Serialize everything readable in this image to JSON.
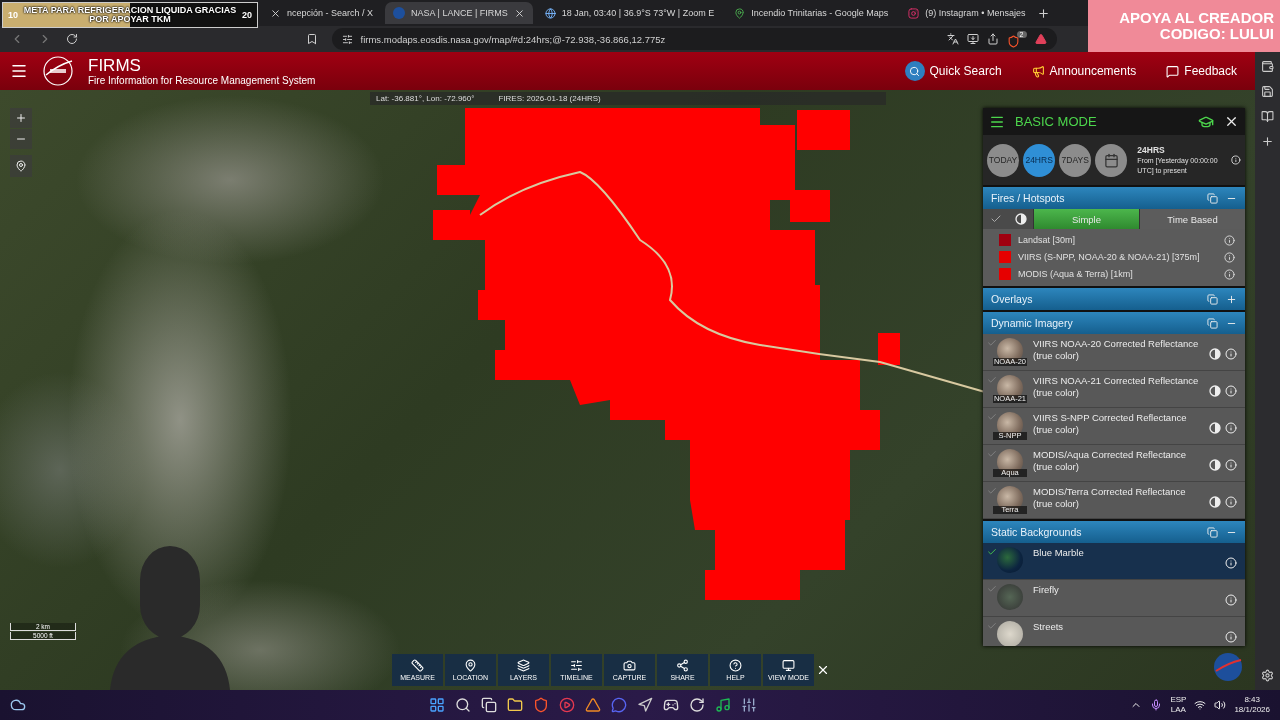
{
  "stream_overlays": {
    "goal": {
      "start": "10",
      "text": "META PARA REFRIGERACION LIQUIDA GRACIAS POR APOYAR TKM",
      "end": "20",
      "level": 0.5
    },
    "creator_banner": {
      "line1": "APOYA AL CREADOR",
      "line2": "CODIGO: LULUI"
    }
  },
  "browser": {
    "tabs": [
      {
        "title": "ncepción - Search / X",
        "kind": "x",
        "selected": false
      },
      {
        "title": "NASA | LANCE | FIRMS",
        "kind": "nasa",
        "selected": true
      },
      {
        "title": "18 Jan, 03:40 | 36.9°S 73°W | Zoom E",
        "kind": "globe",
        "selected": false
      },
      {
        "title": "Incendio Trinitarias - Google Maps",
        "kind": "maps",
        "selected": false
      },
      {
        "title": "(9) Instagram • Mensajes",
        "kind": "instagram",
        "selected": false
      }
    ],
    "url": "firms.modaps.eosdis.nasa.gov/map/#d:24hrs;@-72.938,-36.866,12.775z",
    "shield_badge": "2"
  },
  "header": {
    "title": "FIRMS",
    "subtitle": "Fire Information for Resource Management System",
    "actions": [
      {
        "label": "Quick Search",
        "kind": "search"
      },
      {
        "label": "Announcements",
        "kind": "announce"
      },
      {
        "label": "Feedback",
        "kind": "feedback"
      }
    ]
  },
  "map": {
    "coordinates": "Lat: -36.881°, Lon: -72.960°",
    "fires_date": "FIRES: 2026-01-18 (24HRS)",
    "scale": [
      "2 km",
      "5000 ft"
    ]
  },
  "panel": {
    "title": "BASIC MODE",
    "time_buttons": [
      {
        "label": "TODAY",
        "selected": false
      },
      {
        "label": "24HRS",
        "selected": true
      },
      {
        "label": "7DAYS",
        "selected": false
      }
    ],
    "range_title": "24HRS",
    "range_text": "From [Yesterday 00:00:00 UTC] to present",
    "sections": [
      {
        "title": "Fires / Hotspots",
        "kind": "hotspots",
        "expanded": true,
        "modes": [
          {
            "label": "Simple",
            "selected": true
          },
          {
            "label": "Time Based",
            "selected": false
          }
        ],
        "legend": [
          {
            "label": "Landsat [30m]",
            "color": "#a00010"
          },
          {
            "label": "VIIRS (S-NPP, NOAA-20 & NOAA-21) [375m]",
            "color": "#e60000"
          },
          {
            "label": "MODIS (Aqua & Terra) [1km]",
            "color": "#e60000"
          }
        ]
      },
      {
        "title": "Overlays",
        "kind": "layers",
        "expanded": false
      },
      {
        "title": "Dynamic Imagery",
        "kind": "layers",
        "expanded": true,
        "layers": [
          {
            "name": "VIIRS NOAA-20 Corrected Reflectance (true color)",
            "thumb_label": "NOAA-20",
            "kind": "satellite",
            "checked": false,
            "opacity_control": true
          },
          {
            "name": "VIIRS NOAA-21 Corrected Reflectance (true color)",
            "thumb_label": "NOAA-21",
            "kind": "satellite",
            "checked": false,
            "opacity_control": true
          },
          {
            "name": "VIIRS S-NPP Corrected Reflectance (true color)",
            "thumb_label": "S-NPP",
            "kind": "satellite",
            "checked": false,
            "opacity_control": true
          },
          {
            "name": "MODIS/Aqua Corrected Reflectance (true color)",
            "thumb_label": "Aqua",
            "kind": "satellite",
            "checked": false,
            "opacity_control": true
          },
          {
            "name": "MODIS/Terra Corrected Reflectance (true color)",
            "thumb_label": "Terra",
            "kind": "satellite",
            "checked": false,
            "opacity_control": true
          }
        ]
      },
      {
        "title": "Static Backgrounds",
        "kind": "layers",
        "expanded": true,
        "layers": [
          {
            "name": "Blue Marble",
            "kind": "globe",
            "checked": true,
            "opacity_control": false
          },
          {
            "name": "Firefly",
            "kind": "dark",
            "checked": false,
            "opacity_control": false
          },
          {
            "name": "Streets",
            "kind": "streets",
            "checked": false,
            "opacity_control": false
          }
        ]
      }
    ]
  },
  "toolbar": [
    {
      "label": "MEASURE",
      "kind": "measure"
    },
    {
      "label": "LOCATION",
      "kind": "location"
    },
    {
      "label": "LAYERS",
      "kind": "layers"
    },
    {
      "label": "TIMELINE",
      "kind": "timeline"
    },
    {
      "label": "CAPTURE",
      "kind": "capture"
    },
    {
      "label": "SHARE",
      "kind": "share"
    },
    {
      "label": "HELP",
      "kind": "help"
    },
    {
      "label": "VIEW MODE",
      "kind": "viewmode"
    }
  ],
  "taskbar": {
    "language": "ESP",
    "layout": "LAA",
    "time": "8:43",
    "date": "18/1/2026"
  }
}
